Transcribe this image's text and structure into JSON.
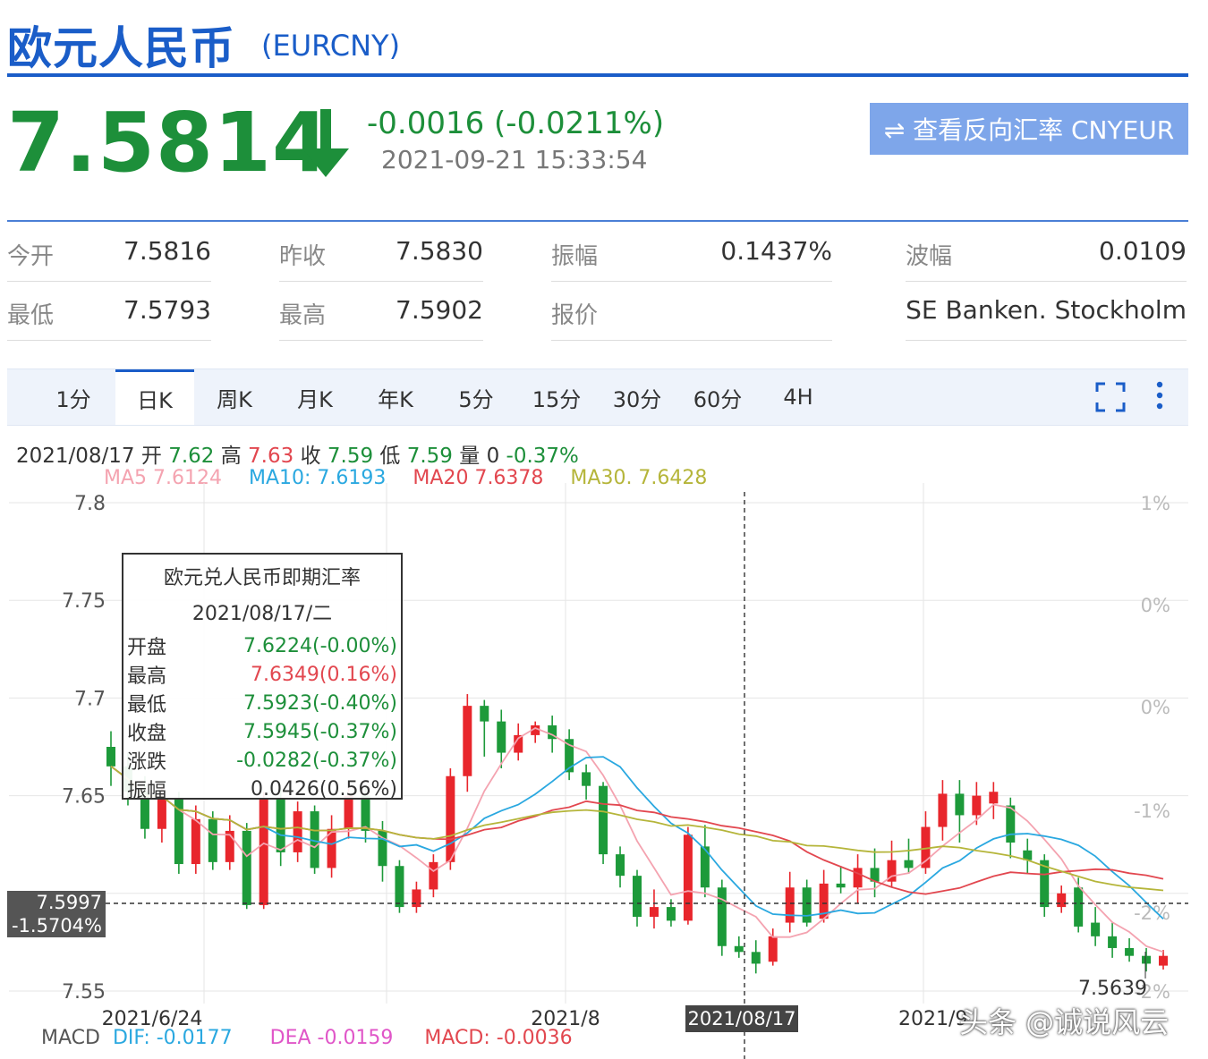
{
  "header": {
    "title": "欧元人民币",
    "symbol": "(EURCNY)",
    "price": "7.5814",
    "change": "-0.0016 (-0.0211%)",
    "timestamp": "2021-09-21 15:33:54",
    "reverse_button": "⇌ 查看反向汇率 CNYEUR",
    "price_color": "#1d8f3a",
    "accent_color": "#1a5dc8"
  },
  "stats": [
    {
      "label": "今开",
      "value": "7.5816"
    },
    {
      "label": "昨收",
      "value": "7.5830"
    },
    {
      "label": "振幅",
      "value": "0.1437%"
    },
    {
      "label": "波幅",
      "value": "0.0109"
    },
    {
      "label": "最低",
      "value": "7.5793"
    },
    {
      "label": "最高",
      "value": "7.5902"
    },
    {
      "label": "报价",
      "value": ""
    },
    {
      "label": "",
      "value": "SE Banken. Stockholm"
    }
  ],
  "tabs": [
    "1分",
    "日K",
    "周K",
    "月K",
    "年K",
    "5分",
    "15分",
    "30分",
    "60分",
    "4H"
  ],
  "active_tab": "日K",
  "toolbar_icons": [
    "fullscreen-icon",
    "more-vertical-icon"
  ],
  "ohlc": {
    "date": "2021/08/17",
    "open_label": "开",
    "open": "7.62",
    "high_label": "高",
    "high": "7.63",
    "close_label": "收",
    "close": "7.59",
    "low_label": "低",
    "low": "7.59",
    "vol_label": "量",
    "vol": "0",
    "pct": "-0.37%"
  },
  "ma": [
    {
      "label": "MA5  7.6124",
      "color": "#f4a3b0"
    },
    {
      "label": "MA10: 7.6193",
      "color": "#2aa8e0"
    },
    {
      "label": "MA20  7.6378",
      "color": "#e2474f"
    },
    {
      "label": "MA30. 7.6428",
      "color": "#b5b53a"
    }
  ],
  "tooltip": {
    "title": "欧元兑人民币即期汇率",
    "date": "2021/08/17/二",
    "rows": [
      {
        "label": "开盘",
        "value": "7.6224(-0.00%)",
        "color": "#1d8f3a"
      },
      {
        "label": "最高",
        "value": "7.6349(0.16%)",
        "color": "#e2474f"
      },
      {
        "label": "最低",
        "value": "7.5923(-0.40%)",
        "color": "#1d8f3a"
      },
      {
        "label": "收盘",
        "value": "7.5945(-0.37%)",
        "color": "#1d8f3a"
      },
      {
        "label": "涨跌",
        "value": "-0.0282(-0.37%)",
        "color": "#1d8f3a"
      },
      {
        "label": "振幅",
        "value": "0.0426(0.56%)",
        "color": "#333333"
      }
    ]
  },
  "cursor": {
    "price": "7.5997",
    "pct": "-1.5704%",
    "date": "2021/08/17"
  },
  "macd": {
    "label": "MACD",
    "dif": "DIF: -0.0177",
    "dea": "DEA  -0.0159",
    "macd": "MACD: -0.0036",
    "dif_color": "#2aa8e0",
    "dea_color": "#e056c8",
    "macd_color": "#e2474f"
  },
  "watermark": "头条 @诚说风云",
  "chart_data": {
    "type": "candlestick",
    "ylim": [
      7.55,
      7.8
    ],
    "y_ticks": [
      "7.8",
      "7.75",
      "7.7",
      "7.65",
      "7.55"
    ],
    "pct_ticks": [
      "1%",
      "0%",
      "0%",
      "-1%",
      "-2%",
      "-2%"
    ],
    "x_labels": [
      "2021/6/24",
      "2021/8",
      "2021/9"
    ],
    "min_label": "7.5639",
    "up_color": "#e8262c",
    "down_color": "#1d9a3a",
    "candles": [
      [
        7.675,
        7.665,
        7.683,
        7.655
      ],
      [
        7.665,
        7.652,
        7.672,
        7.645
      ],
      [
        7.652,
        7.633,
        7.66,
        7.628
      ],
      [
        7.633,
        7.649,
        7.655,
        7.626
      ],
      [
        7.649,
        7.615,
        7.652,
        7.61
      ],
      [
        7.615,
        7.638,
        7.645,
        7.61
      ],
      [
        7.638,
        7.616,
        7.642,
        7.612
      ],
      [
        7.616,
        7.632,
        7.64,
        7.612
      ],
      [
        7.632,
        7.594,
        7.636,
        7.592
      ],
      [
        7.594,
        7.648,
        7.652,
        7.592
      ],
      [
        7.648,
        7.621,
        7.654,
        7.614
      ],
      [
        7.621,
        7.642,
        7.647,
        7.616
      ],
      [
        7.642,
        7.613,
        7.645,
        7.61
      ],
      [
        7.613,
        7.633,
        7.64,
        7.608
      ],
      [
        7.633,
        7.65,
        7.655,
        7.628
      ],
      [
        7.65,
        7.632,
        7.654,
        7.626
      ],
      [
        7.632,
        7.614,
        7.637,
        7.606
      ],
      [
        7.614,
        7.593,
        7.617,
        7.59
      ],
      [
        7.593,
        7.602,
        7.606,
        7.59
      ],
      [
        7.602,
        7.616,
        7.62,
        7.598
      ],
      [
        7.616,
        7.66,
        7.664,
        7.612
      ],
      [
        7.66,
        7.696,
        7.702,
        7.652
      ],
      [
        7.696,
        7.688,
        7.699,
        7.67
      ],
      [
        7.688,
        7.672,
        7.694,
        7.664
      ],
      [
        7.672,
        7.681,
        7.687,
        7.668
      ],
      [
        7.681,
        7.686,
        7.688,
        7.677
      ],
      [
        7.686,
        7.679,
        7.691,
        7.672
      ],
      [
        7.679,
        7.662,
        7.684,
        7.658
      ],
      [
        7.662,
        7.655,
        7.666,
        7.648
      ],
      [
        7.655,
        7.62,
        7.657,
        7.615
      ],
      [
        7.62,
        7.609,
        7.624,
        7.603
      ],
      [
        7.609,
        7.588,
        7.612,
        7.583
      ],
      [
        7.588,
        7.593,
        7.602,
        7.582
      ],
      [
        7.593,
        7.586,
        7.597,
        7.583
      ],
      [
        7.586,
        7.63,
        7.634,
        7.584
      ],
      [
        7.624,
        7.603,
        7.635,
        7.598
      ],
      [
        7.603,
        7.573,
        7.607,
        7.568
      ],
      [
        7.573,
        7.57,
        7.578,
        7.567
      ],
      [
        7.57,
        7.564,
        7.576,
        7.559
      ],
      [
        7.565,
        7.578,
        7.582,
        7.563
      ],
      [
        7.585,
        7.603,
        7.611,
        7.58
      ],
      [
        7.603,
        7.585,
        7.607,
        7.583
      ],
      [
        7.587,
        7.605,
        7.612,
        7.585
      ],
      [
        7.605,
        7.603,
        7.614,
        7.6
      ],
      [
        7.603,
        7.613,
        7.62,
        7.595
      ],
      [
        7.613,
        7.606,
        7.623,
        7.598
      ],
      [
        7.606,
        7.617,
        7.627,
        7.603
      ],
      [
        7.617,
        7.613,
        7.628,
        7.61
      ],
      [
        7.613,
        7.634,
        7.642,
        7.61
      ],
      [
        7.634,
        7.651,
        7.658,
        7.627
      ],
      [
        7.651,
        7.64,
        7.658,
        7.626
      ],
      [
        7.64,
        7.65,
        7.657,
        7.635
      ],
      [
        7.646,
        7.652,
        7.657,
        7.638
      ],
      [
        7.645,
        7.626,
        7.649,
        7.618
      ],
      [
        7.622,
        7.617,
        7.628,
        7.61
      ],
      [
        7.617,
        7.593,
        7.62,
        7.588
      ],
      [
        7.593,
        7.6,
        7.604,
        7.59
      ],
      [
        7.603,
        7.583,
        7.608,
        7.58
      ],
      [
        7.585,
        7.578,
        7.593,
        7.573
      ],
      [
        7.578,
        7.572,
        7.585,
        7.567
      ],
      [
        7.572,
        7.568,
        7.577,
        7.565
      ],
      [
        7.568,
        7.564,
        7.572,
        7.56
      ],
      [
        7.563,
        7.568,
        7.571,
        7.561
      ]
    ],
    "ma": [
      {
        "name": "MA5",
        "color": "#f4a3b0",
        "values": [
          7.6124
        ]
      },
      {
        "name": "MA10",
        "color": "#2aa8e0",
        "values": [
          7.6193
        ]
      },
      {
        "name": "MA20",
        "color": "#e2474f",
        "values": [
          7.6378
        ]
      },
      {
        "name": "MA30",
        "color": "#b5b53a",
        "values": [
          7.6428
        ]
      }
    ]
  }
}
